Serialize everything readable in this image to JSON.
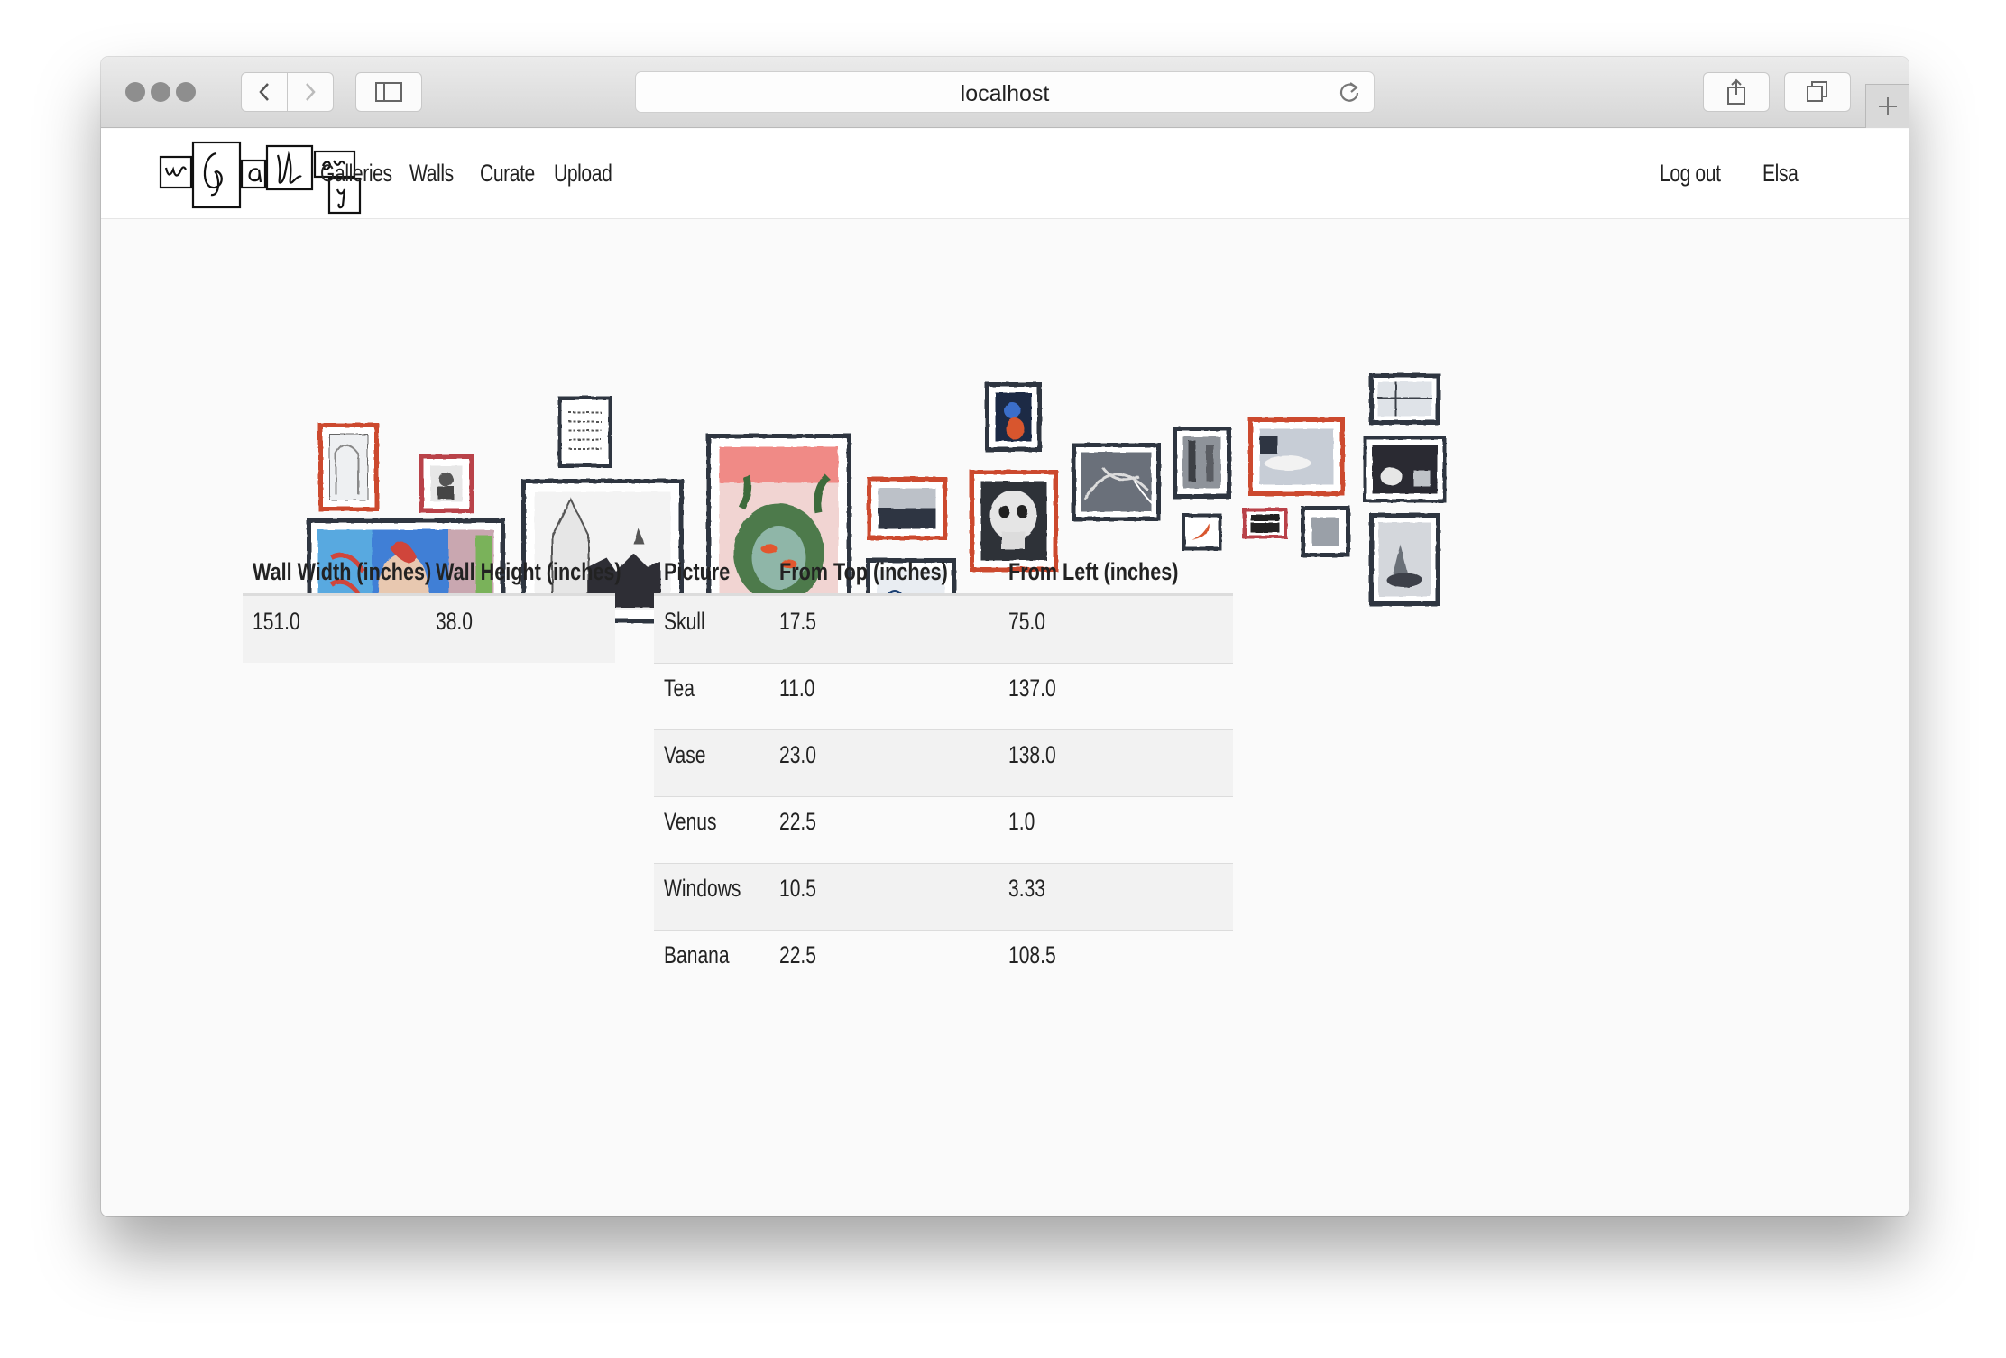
{
  "browser": {
    "url": "localhost"
  },
  "nav": {
    "logo_text": "wGallery",
    "links": [
      "Galleries",
      "Walls",
      "Curate",
      "Upload"
    ],
    "logout": "Log out",
    "user": "Elsa"
  },
  "wall_table": {
    "headers": [
      "Wall Width (inches)",
      "Wall Height (inches)"
    ],
    "row": [
      "151.0",
      "38.0"
    ]
  },
  "pictures_table": {
    "headers": [
      "Picture",
      "From Top (inches)",
      "From Left (inches)"
    ],
    "rows": [
      [
        "Skull",
        "17.5",
        "75.0"
      ],
      [
        "Tea",
        "11.0",
        "137.0"
      ],
      [
        "Vase",
        "23.0",
        "138.0"
      ],
      [
        "Venus",
        "22.5",
        "1.0"
      ],
      [
        "Windows",
        "10.5",
        "3.33"
      ],
      [
        "Banana",
        "22.5",
        "108.5"
      ]
    ]
  },
  "colors": {
    "frame_dark": "#2d3440",
    "frame_red": "#cc4a2e",
    "row_stripe": "#f2f2f2"
  }
}
